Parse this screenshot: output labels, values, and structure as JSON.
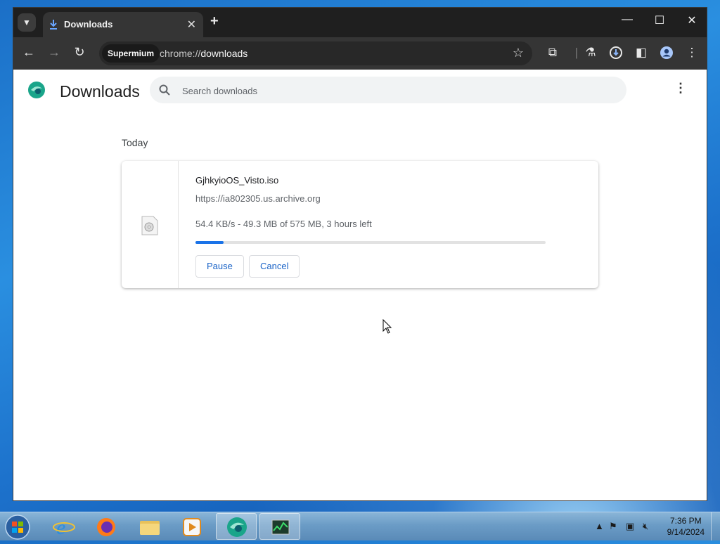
{
  "browser": {
    "tab": {
      "title": "Downloads"
    },
    "omnibox": {
      "chip": "Supermium",
      "url_scheme": "chrome://",
      "url_host": "downloads"
    }
  },
  "page": {
    "title": "Downloads",
    "search": {
      "placeholder": "Search downloads"
    },
    "date_group": "Today",
    "downloads": [
      {
        "file_name": "GjhkyioOS_Visto.iso",
        "url": "https://ia802305.us.archive.org",
        "status": "54.4 KB/s - 49.3 MB of 575 MB, 3 hours left",
        "progress": 0.08,
        "pause_label": "Pause",
        "cancel_label": "Cancel"
      }
    ]
  },
  "taskbar": {
    "time": "7:36 PM",
    "date": "9/14/2024"
  },
  "colors": {
    "accent": "#1a73e8",
    "button_text": "#1a63c7",
    "titlebar": "#1f1f1f",
    "toolbar": "#353535"
  }
}
